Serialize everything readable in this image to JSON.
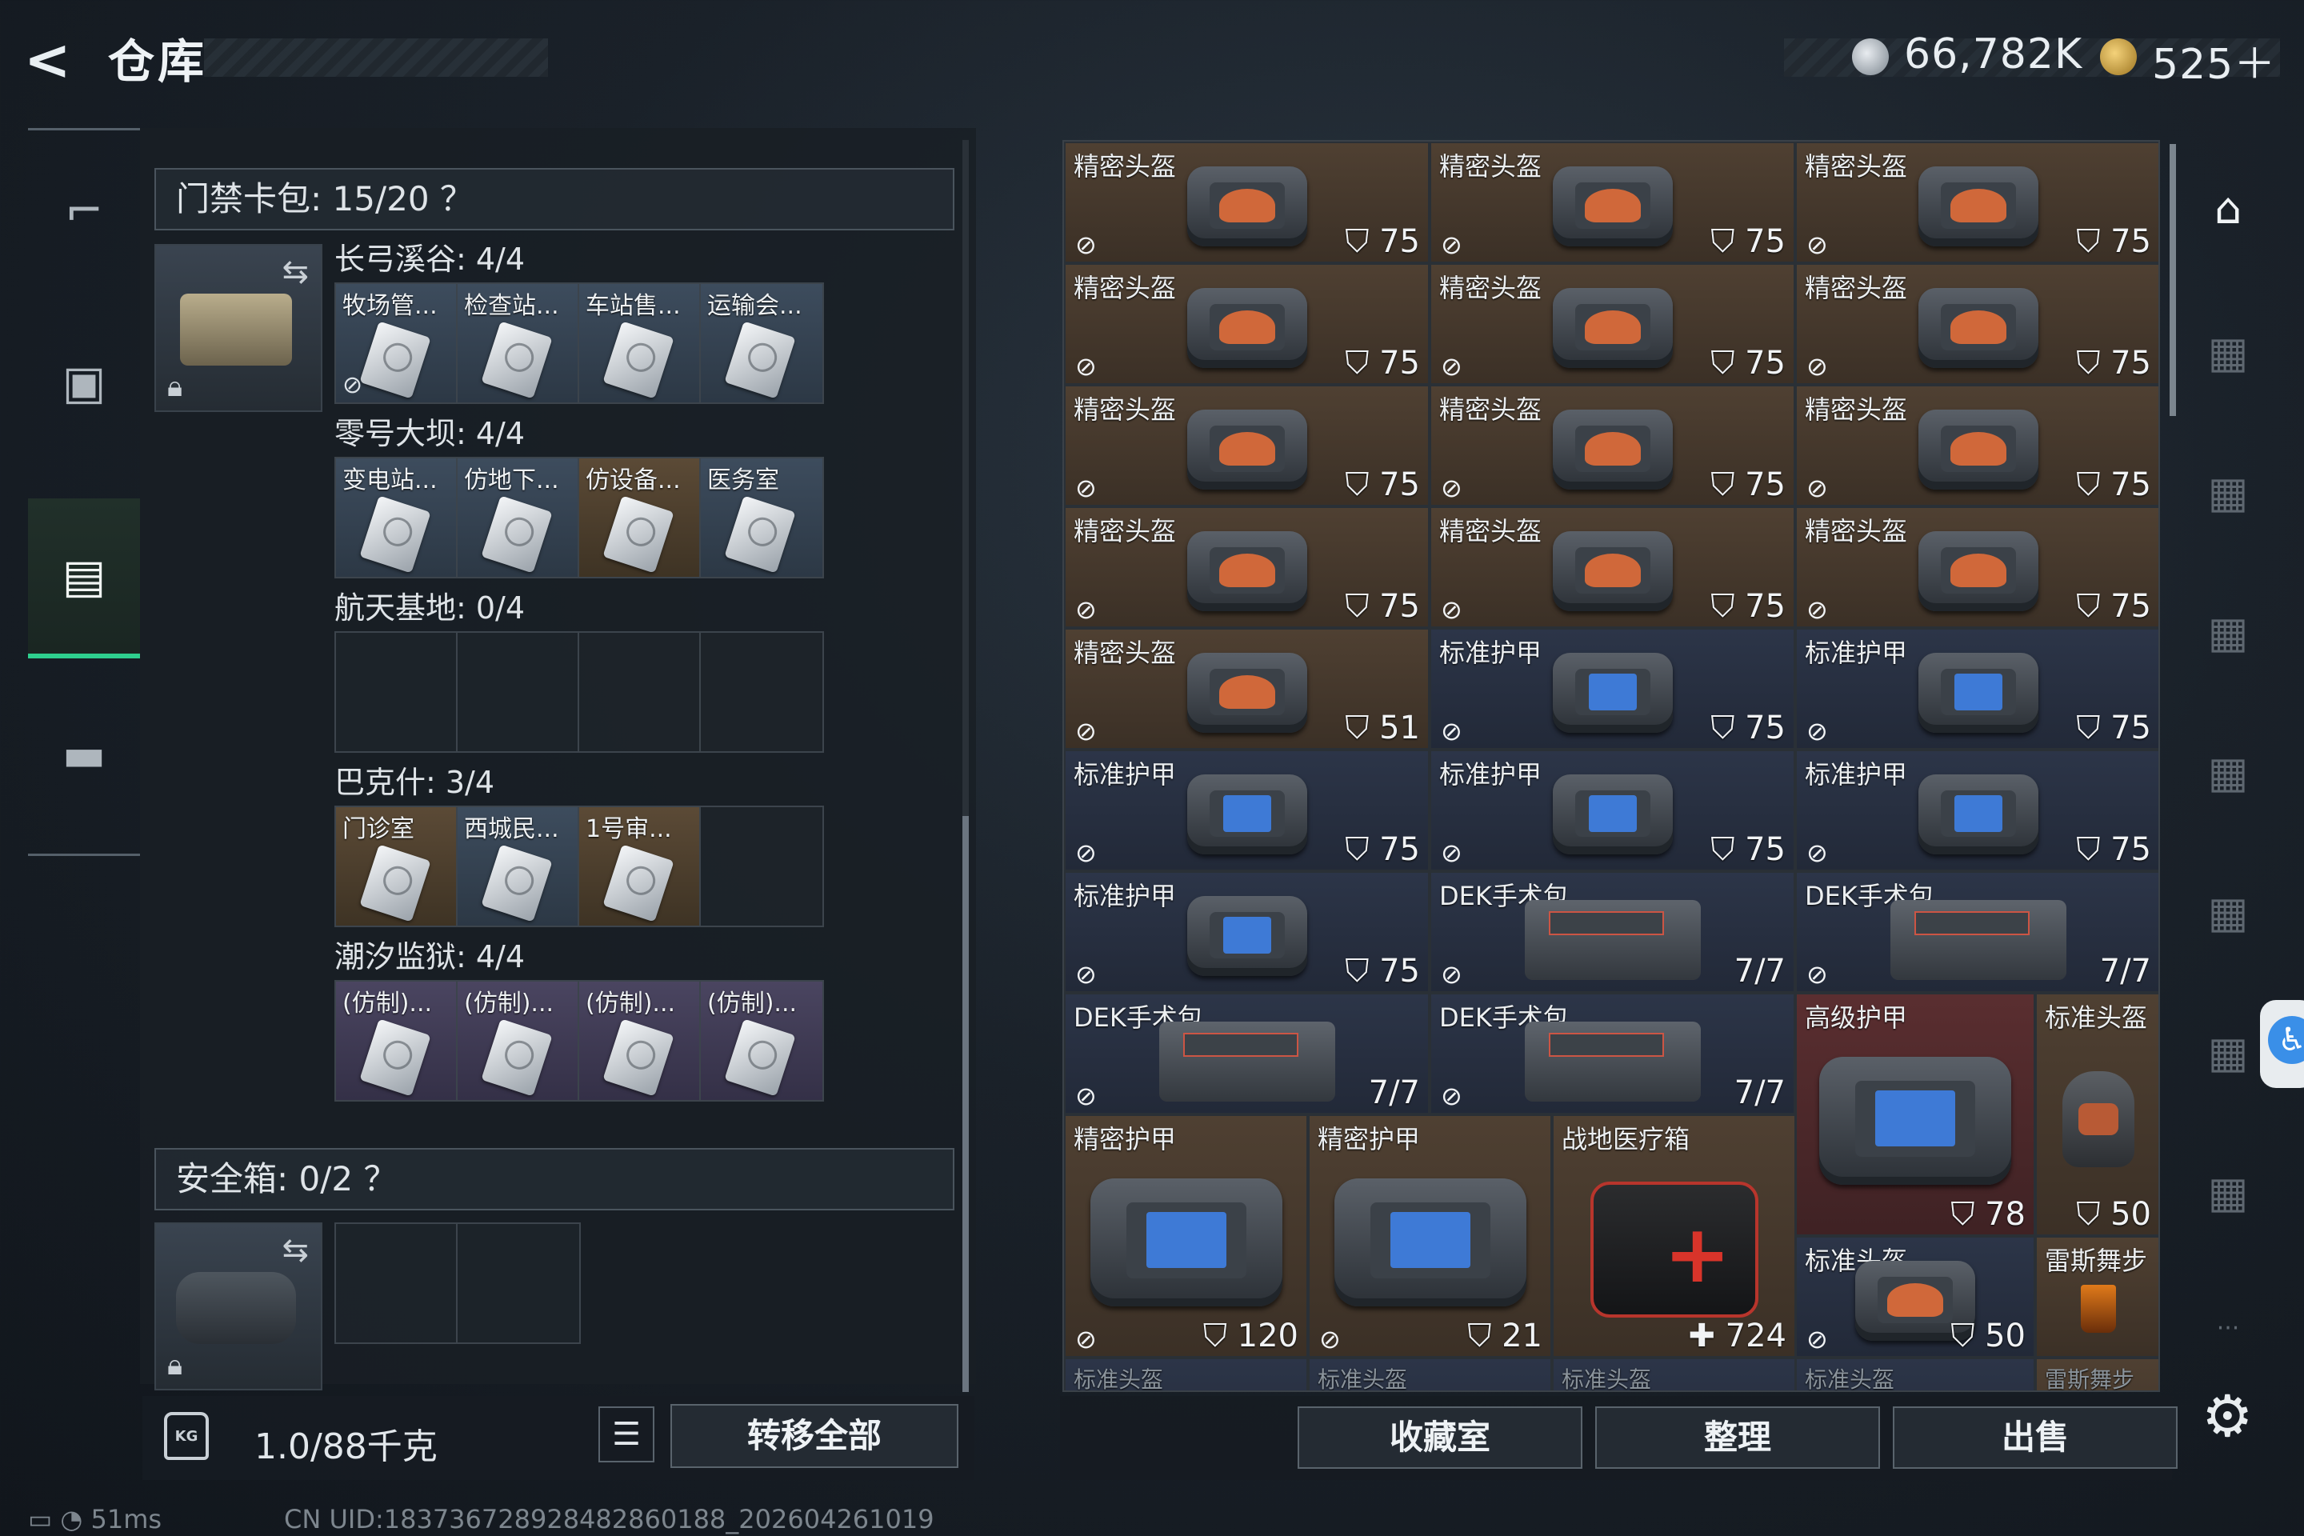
{
  "header": {
    "back_icon": "back-arrow-icon",
    "title": "仓库",
    "currency1": "66,782K",
    "currency2": "525＋"
  },
  "left_nav": [
    "gun-icon",
    "backpack-icon",
    "container-icon",
    "toolbox-icon"
  ],
  "keycard_pack": {
    "label": "门禁卡包: 15/20 ？",
    "groups": [
      {
        "title": "长弓溪谷: 4/4",
        "cards": [
          {
            "label": "牧场管...",
            "color": "blue"
          },
          {
            "label": "检查站...",
            "color": "blue"
          },
          {
            "label": "车站售...",
            "color": "blue"
          },
          {
            "label": "运输会...",
            "color": "blue"
          }
        ]
      },
      {
        "title": "零号大坝: 4/4",
        "cards": [
          {
            "label": "变电站...",
            "color": "blue"
          },
          {
            "label": "仿地下...",
            "color": "blue"
          },
          {
            "label": "仿设备...",
            "color": "gold"
          },
          {
            "label": "医务室",
            "color": "blue"
          }
        ]
      },
      {
        "title": "航天基地: 0/4",
        "cards": []
      },
      {
        "title": "巴克什: 3/4",
        "cards": [
          {
            "label": "门诊室",
            "color": "gold"
          },
          {
            "label": "西城民...",
            "color": "blue"
          },
          {
            "label": "1号审...",
            "color": "gold"
          }
        ]
      },
      {
        "title": "潮汐监狱: 4/4",
        "cards": [
          {
            "label": "(仿制)...",
            "color": "purple"
          },
          {
            "label": "(仿制)...",
            "color": "purple"
          },
          {
            "label": "(仿制)...",
            "color": "purple"
          },
          {
            "label": "(仿制)...",
            "color": "purple"
          }
        ]
      }
    ]
  },
  "safe_box": {
    "label": "安全箱: 0/2 ？"
  },
  "weight": {
    "value": "1.0/88千克",
    "kg_icon": "KG"
  },
  "buttons": {
    "list": "☰",
    "transfer_all": "转移全部",
    "collection": "收藏室",
    "organize": "整理",
    "sell": "出售"
  },
  "status": {
    "ping": "51ms",
    "uid": "CN UID:18373672892848286018​8_202604261019"
  },
  "items": [
    {
      "name": "精密头盔",
      "stat": "75",
      "kind": "helmet-bag",
      "bg": "brown"
    },
    {
      "name": "精密头盔",
      "stat": "75",
      "kind": "helmet-bag",
      "bg": "brown"
    },
    {
      "name": "精密头盔",
      "stat": "75",
      "kind": "helmet-bag",
      "bg": "brown"
    },
    {
      "name": "精密头盔",
      "stat": "75",
      "kind": "helmet-bag",
      "bg": "brown"
    },
    {
      "name": "精密头盔",
      "stat": "75",
      "kind": "helmet-bag",
      "bg": "brown"
    },
    {
      "name": "精密头盔",
      "stat": "75",
      "kind": "helmet-bag",
      "bg": "brown"
    },
    {
      "name": "精密头盔",
      "stat": "75",
      "kind": "helmet-bag",
      "bg": "brown"
    },
    {
      "name": "精密头盔",
      "stat": "75",
      "kind": "helmet-bag",
      "bg": "brown"
    },
    {
      "name": "精密头盔",
      "stat": "75",
      "kind": "helmet-bag",
      "bg": "brown"
    },
    {
      "name": "精密头盔",
      "stat": "75",
      "kind": "helmet-bag",
      "bg": "brown"
    },
    {
      "name": "精密头盔",
      "stat": "75",
      "kind": "helmet-bag",
      "bg": "brown"
    },
    {
      "name": "精密头盔",
      "stat": "75",
      "kind": "helmet-bag",
      "bg": "brown"
    },
    {
      "name": "精密头盔",
      "stat": "51",
      "kind": "helmet-bag",
      "bg": "brown"
    },
    {
      "name": "标准护甲",
      "stat": "75",
      "kind": "armor-bag",
      "bg": "navy"
    },
    {
      "name": "标准护甲",
      "stat": "75",
      "kind": "armor-bag",
      "bg": "navy"
    },
    {
      "name": "标准护甲",
      "stat": "75",
      "kind": "armor-bag",
      "bg": "navy"
    },
    {
      "name": "标准护甲",
      "stat": "75",
      "kind": "armor-bag",
      "bg": "navy"
    },
    {
      "name": "标准护甲",
      "stat": "75",
      "kind": "armor-bag",
      "bg": "navy"
    },
    {
      "name": "标准护甲",
      "stat": "75",
      "kind": "armor-bag",
      "bg": "navy"
    },
    {
      "name": "DEK手术包",
      "stat": "7/7",
      "kind": "surgery-kit",
      "bg": "navy"
    },
    {
      "name": "DEK手术包",
      "stat": "7/7",
      "kind": "surgery-kit",
      "bg": "navy"
    },
    {
      "name": "DEK手术包",
      "stat": "7/7",
      "kind": "surgery-kit",
      "bg": "navy"
    },
    {
      "name": "DEK手术包",
      "stat": "7/7",
      "kind": "surgery-kit",
      "bg": "navy"
    },
    {
      "name": "高级护甲",
      "stat": "78",
      "kind": "armor-big",
      "bg": "red"
    },
    {
      "name": "标准头盔",
      "stat": "50",
      "kind": "helmet",
      "bg": "brown"
    },
    {
      "name": "精密护甲",
      "stat": "120",
      "kind": "armor-wide",
      "bg": "brown"
    },
    {
      "name": "精密护甲",
      "stat": "21",
      "kind": "armor-wide",
      "bg": "brown"
    },
    {
      "name": "战地医疗箱",
      "stat": "724",
      "kind": "first-aid-box",
      "bg": "brown"
    },
    {
      "name": "标准头盔",
      "stat": "50",
      "kind": "helmet-bag",
      "bg": "navy"
    },
    {
      "name": "雷斯舞步",
      "stat": "",
      "kind": "drink",
      "bg": "brown"
    },
    {
      "name": "标准头盔",
      "stat": "",
      "kind": "peek",
      "bg": "navy"
    },
    {
      "name": "标准头盔",
      "stat": "",
      "kind": "peek",
      "bg": "navy"
    },
    {
      "name": "标准头盔",
      "stat": "",
      "kind": "peek",
      "bg": "navy"
    },
    {
      "name": "标准头盔",
      "stat": "",
      "kind": "peek",
      "bg": "navy"
    },
    {
      "name": "雷斯舞步",
      "stat": "",
      "kind": "peek",
      "bg": "brown"
    }
  ],
  "right_nav": [
    "warehouse-home-icon",
    "tab-iv-1-icon",
    "tab-iv-2-icon",
    "tab-iv-3-icon",
    "tab-iv-4-icon",
    "tab-iv-5-icon",
    "tab-iv-6-icon",
    "tab-iv-7-icon",
    "more-icon"
  ]
}
